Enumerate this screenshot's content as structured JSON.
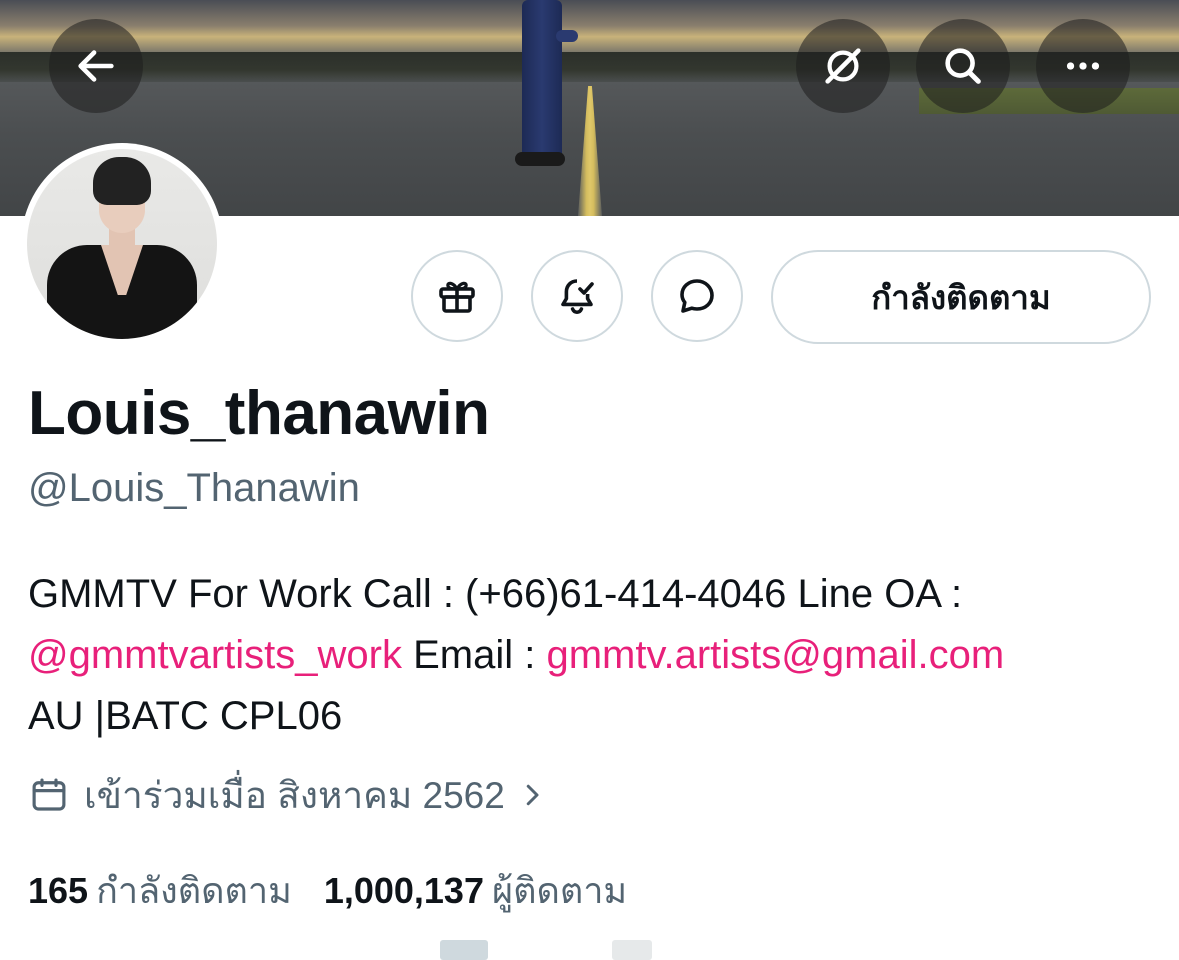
{
  "header": {
    "back_icon": "arrow-left-icon",
    "grok_icon": "grok-icon",
    "search_icon": "search-icon",
    "more_icon": "more-horizontal-icon"
  },
  "profile": {
    "display_name": "Louis_thanawin",
    "handle": "@Louis_Thanawin",
    "bio": {
      "line1": "GMMTV For Work Call : (+66)61-414-4046 Line OA :",
      "link1": "@gmmtvartists_work",
      "line2_mid": " Email : ",
      "link2": "gmmtv.artists@gmail.com",
      "line3": "AU |BATC CPL06"
    },
    "joined": "เข้าร่วมเมื่อ สิงหาคม 2562",
    "following_count": "165",
    "following_label": "กำลังติดตาม",
    "followers_count": "1,000,137",
    "followers_label": "ผู้ติดตาม"
  },
  "actions": {
    "gift_icon": "gift-icon",
    "notify_icon": "bell-check-icon",
    "message_icon": "message-icon",
    "follow_label": "กำลังติดตาม"
  },
  "colors": {
    "link": "#e8207a",
    "secondary_text": "#536471",
    "border": "#cfd9de"
  }
}
